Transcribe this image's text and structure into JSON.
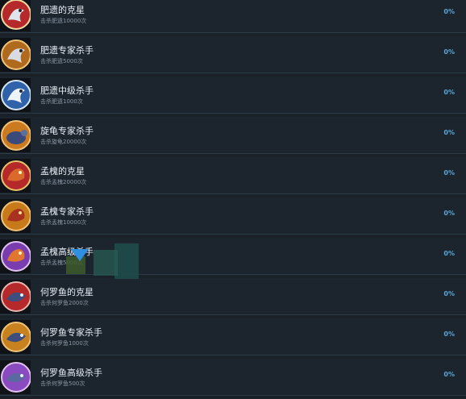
{
  "achievements": [
    {
      "title": "肥遗的克星",
      "subtitle": "击杀肥遗10000次",
      "percent": "0%",
      "icon": "feiyi-boss-icon",
      "colors": [
        "#b5292b",
        "#f2d8a0"
      ]
    },
    {
      "title": "肥遗专家杀手",
      "subtitle": "击杀肥遗5000次",
      "percent": "0%",
      "icon": "feiyi-expert-icon",
      "colors": [
        "#b06a1e",
        "#f0c37a"
      ]
    },
    {
      "title": "肥遗中级杀手",
      "subtitle": "击杀肥遗1000次",
      "percent": "0%",
      "icon": "feiyi-mid-icon",
      "colors": [
        "#2f62a8",
        "#d7e6f5"
      ]
    },
    {
      "title": "旋龟专家杀手",
      "subtitle": "击杀旋龟20000次",
      "percent": "0%",
      "icon": "xuangui-expert-icon",
      "colors": [
        "#cc7a1f",
        "#3a4a7a"
      ]
    },
    {
      "title": "孟槐的克星",
      "subtitle": "击杀孟槐20000次",
      "percent": "0%",
      "icon": "menghuai-boss-icon",
      "colors": [
        "#b5292b",
        "#e7c36b"
      ]
    },
    {
      "title": "孟槐专家杀手",
      "subtitle": "击杀孟槐10000次",
      "percent": "0%",
      "icon": "menghuai-expert-icon",
      "colors": [
        "#c77a1a",
        "#a8321f"
      ]
    },
    {
      "title": "孟槐高级杀手",
      "subtitle": "击杀孟槐5000次",
      "percent": "0%",
      "icon": "menghuai-high-icon",
      "colors": [
        "#7a3db0",
        "#e0762f"
      ]
    },
    {
      "title": "何罗鱼的克星",
      "subtitle": "击杀何罗鱼2000次",
      "percent": "0%",
      "icon": "heluoyu-boss-icon",
      "colors": [
        "#b5292b",
        "#3c4e7e"
      ]
    },
    {
      "title": "何罗鱼专家杀手",
      "subtitle": "击杀何罗鱼1000次",
      "percent": "0%",
      "icon": "heluoyu-expert-icon",
      "colors": [
        "#c7821f",
        "#3c4e7e"
      ]
    },
    {
      "title": "何罗鱼高级杀手",
      "subtitle": "击杀何罗鱼500次",
      "percent": "0%",
      "icon": "heluoyu-high-icon",
      "colors": [
        "#8a4ac0",
        "#5a6aa0"
      ]
    }
  ]
}
